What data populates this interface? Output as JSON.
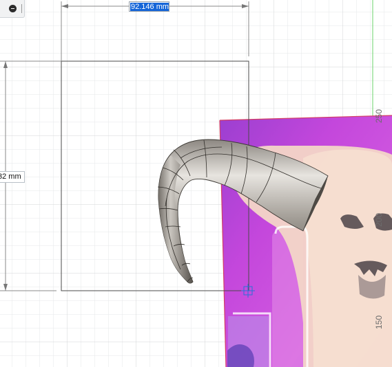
{
  "toolbar": {
    "icons": [
      "minus-circle-icon",
      "separator-icon"
    ]
  },
  "dimensions": {
    "horizontal_value": "92.146 mm",
    "vertical_value_partial": "32 mm"
  },
  "ruler": {
    "ticks": [
      "250",
      "200",
      "150"
    ]
  },
  "colors": {
    "grid": "#e4e5e6",
    "grid_major": "#d2d4d6",
    "dimension_line": "#7a7a7a",
    "sketch_line": "#444444",
    "selection_blue": "#1565d8",
    "canvas_magenta": "#c23dd8",
    "horn_shade_dark": "#5b5752",
    "horn_shade_light": "#d9d6d1",
    "green_axis": "#4fc84f"
  }
}
